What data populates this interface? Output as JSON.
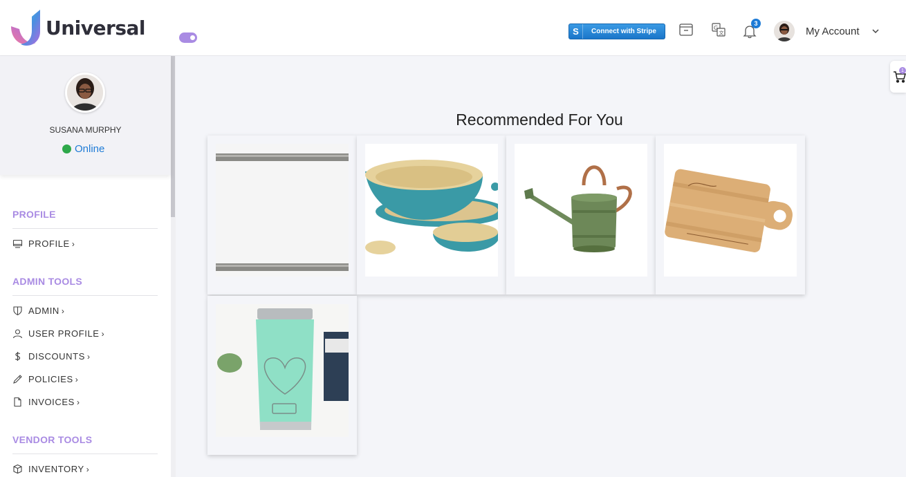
{
  "app": {
    "name": "Universal"
  },
  "header": {
    "stripe_button": {
      "icon_letter": "S",
      "label": "Connect with Stripe"
    },
    "notifications_count": "3",
    "account_label": "My Account"
  },
  "user": {
    "name": "SUSANA MURPHY",
    "status": "Online"
  },
  "sidebar": {
    "sections": [
      {
        "title": "PROFILE",
        "items": [
          {
            "label": "PROFILE",
            "icon": "monitor-icon"
          }
        ]
      },
      {
        "title": "ADMIN TOOLS",
        "items": [
          {
            "label": "ADMIN",
            "icon": "shield-icon"
          },
          {
            "label": "USER PROFILE",
            "icon": "user-icon"
          },
          {
            "label": "DISCOUNTS",
            "icon": "dollar-icon"
          },
          {
            "label": "POLICIES",
            "icon": "pencil-icon"
          },
          {
            "label": "INVOICES",
            "icon": "file-icon"
          }
        ]
      },
      {
        "title": "VENDOR TOOLS",
        "items": [
          {
            "label": "INVENTORY",
            "icon": "box-icon"
          }
        ]
      }
    ],
    "chevron": "›"
  },
  "main": {
    "title": "Recommended For You",
    "products": [
      {
        "image": "wood-frame"
      },
      {
        "image": "bamboo-bowls"
      },
      {
        "image": "watering-can"
      },
      {
        "image": "cutting-board"
      },
      {
        "image": "tumbler"
      }
    ]
  },
  "cart": {
    "count": "1"
  },
  "colors": {
    "accent": "#a98be3",
    "link": "#1e7bd6",
    "online": "#2ea84a",
    "stripe": "#2a88d8"
  }
}
